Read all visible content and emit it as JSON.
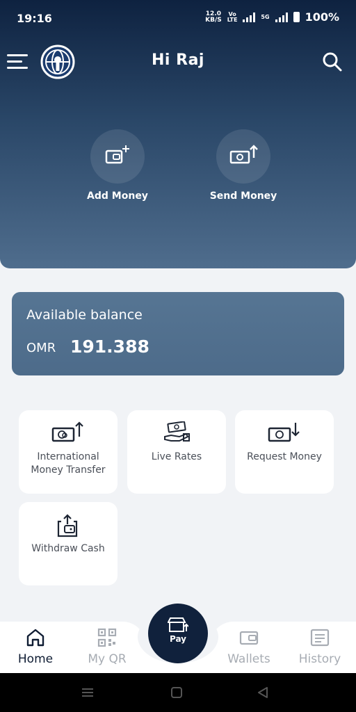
{
  "status_bar": {
    "time": "19:16",
    "net_speed_value": "12.0",
    "net_speed_unit": "KB/S",
    "volte_top": "Vo",
    "volte_bottom": "LTE",
    "network_type": "5G",
    "battery": "100%"
  },
  "header": {
    "greeting": "Hi Raj",
    "menu_icon": "menu-icon",
    "logo_icon": "globe-logo-icon",
    "search_icon": "search-icon"
  },
  "quick_actions": [
    {
      "label": "Add Money",
      "icon": "wallet-add-icon"
    },
    {
      "label": "Send Money",
      "icon": "send-money-icon"
    }
  ],
  "balance": {
    "title": "Available balance",
    "currency": "OMR",
    "amount": "191.388"
  },
  "services": [
    {
      "label": "International Money Transfer",
      "icon": "international-transfer-icon"
    },
    {
      "label": "Live Rates",
      "icon": "live-rates-icon"
    },
    {
      "label": "Request Money",
      "icon": "request-money-icon"
    },
    {
      "label": "Withdraw Cash",
      "icon": "withdraw-cash-icon"
    }
  ],
  "bottom_nav": {
    "items": [
      {
        "label": "Home",
        "icon": "home-icon",
        "active": true
      },
      {
        "label": "My QR",
        "icon": "qr-code-icon",
        "active": false
      },
      {
        "label": "Wallets",
        "icon": "wallet-icon",
        "active": false
      },
      {
        "label": "History",
        "icon": "history-icon",
        "active": false
      }
    ],
    "pay_label": "Pay",
    "pay_icon": "store-pay-icon"
  },
  "colors": {
    "hero_top": "#0e2240",
    "hero_bottom": "#4f6d8d",
    "balance_card": "#567593",
    "pay_button": "#10213c",
    "active_nav": "#0f1c33",
    "inactive_nav": "#a7acb3"
  }
}
